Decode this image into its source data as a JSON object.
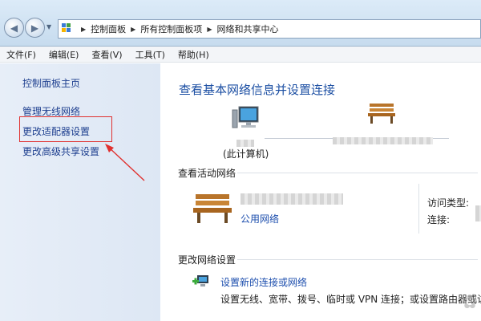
{
  "window": {
    "breadcrumb": [
      "控制面板",
      "所有控制面板项",
      "网络和共享中心"
    ]
  },
  "menu": [
    "文件(F)",
    "编辑(E)",
    "查看(V)",
    "工具(T)",
    "帮助(H)"
  ],
  "sidebar": {
    "items": [
      {
        "label": "控制面板主页"
      },
      {
        "label": "管理无线网络"
      },
      {
        "label": "更改适配器设置"
      },
      {
        "label": "更改高级共享设置"
      }
    ]
  },
  "main": {
    "title": "查看基本网络信息并设置连接",
    "this_computer_label": "(此计算机)",
    "active_networks_title": "查看活动网络",
    "network_type": "公用网络",
    "access_type_label": "访问类型:",
    "connection_label": "连接:",
    "change_settings_title": "更改网络设置",
    "setup_link": "设置新的连接或网络",
    "setup_desc": "设置无线、宽带、拨号、临时或 VPN 连接；或设置路由器或访"
  },
  "colors": {
    "highlight": "#e0312f",
    "link": "#1e4fae",
    "title": "#1c4fa3"
  }
}
